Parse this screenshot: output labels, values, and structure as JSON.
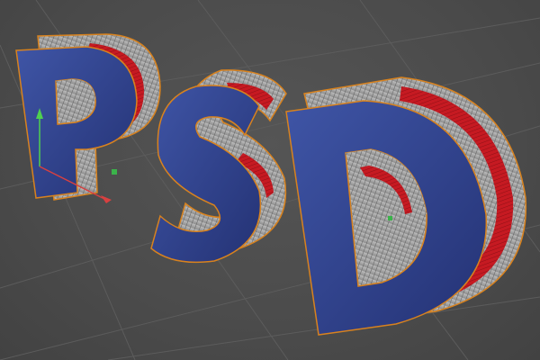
{
  "scene": {
    "text_object": "PSD",
    "letters": [
      "P",
      "S",
      "D"
    ],
    "colors": {
      "background": "#4a4a4a",
      "grid_line": "#5d5d5d",
      "face": "#2f3f86",
      "face_light": "#3d55a8",
      "extrude_gray": "#a9a9a9",
      "extrude_stripe": "#c41a22",
      "selection_outline": "#d8821e",
      "wire": "#5a5a5a",
      "axis_y": "#4fd04f",
      "axis_x": "#d84040"
    },
    "icons": [
      "move-axis-y-icon",
      "move-axis-x-icon",
      "object-pivot-icon"
    ]
  }
}
